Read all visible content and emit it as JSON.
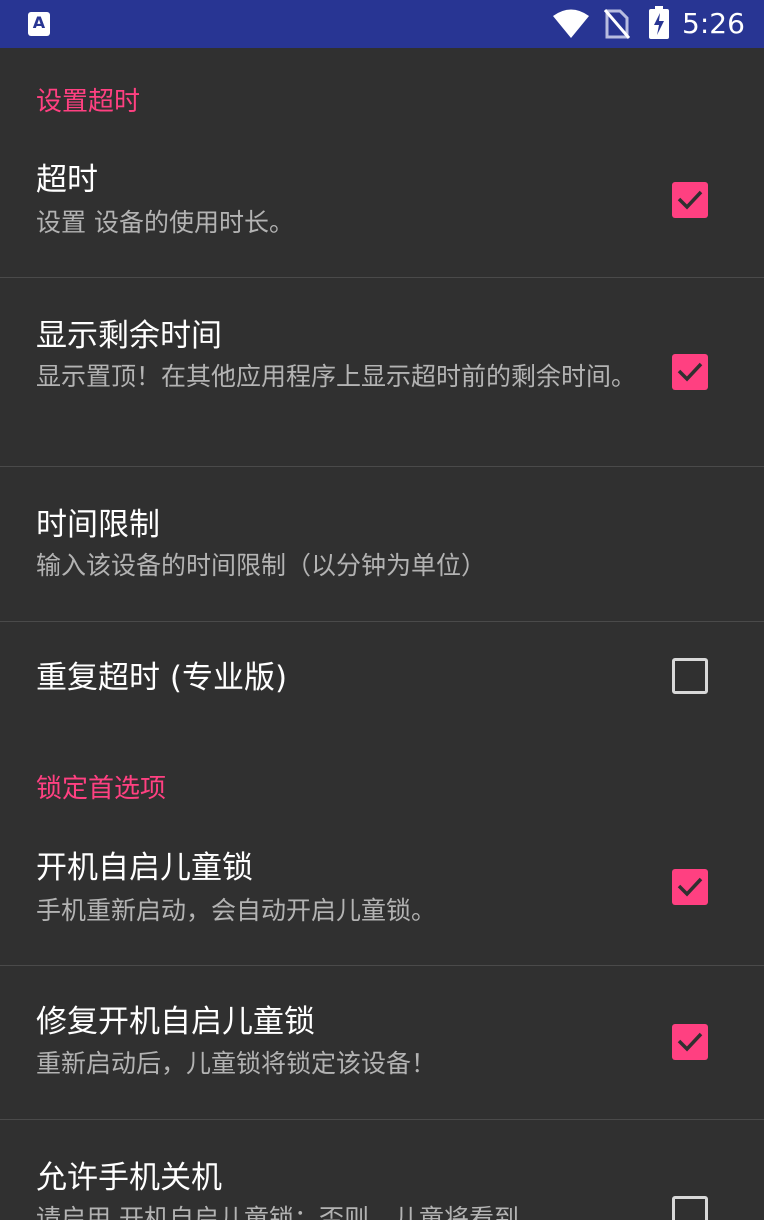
{
  "status_bar": {
    "app_icon_letter": "A",
    "time": "5:26",
    "icons": [
      "wifi-icon",
      "no-sim-icon",
      "battery-charging-icon"
    ]
  },
  "colors": {
    "status_bar": "#283593",
    "background": "#303030",
    "accent": "#ff4081",
    "summary_text": "#b3b3b3"
  },
  "sections": [
    {
      "header": "设置超时",
      "items": [
        {
          "title": "超时",
          "summary": "设置 设备的使用时长。",
          "checked": true
        },
        {
          "title": "显示剩余时间",
          "summary": "显示置顶！在其他应用程序上显示超时前的剩余时间。",
          "checked": true
        },
        {
          "title": "时间限制",
          "summary": "输入该设备的时间限制（以分钟为单位）"
        },
        {
          "title": "重复超时 (专业版)",
          "checked": false
        }
      ]
    },
    {
      "header": "锁定首选项",
      "items": [
        {
          "title": "开机自启儿童锁",
          "summary": "手机重新启动，会自动开启儿童锁。",
          "checked": true
        },
        {
          "title": "修复开机自启儿童锁",
          "summary": "重新启动后，儿童锁将锁定该设备！",
          "checked": true
        },
        {
          "title": "允许手机关机",
          "summary": "请启用 开机自启儿童锁；否则，儿童将看到",
          "checked": false
        }
      ]
    }
  ]
}
